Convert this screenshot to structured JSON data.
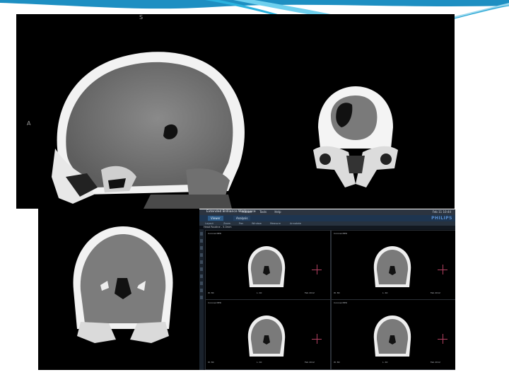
{
  "slide": {
    "accent": "#1a9fd0",
    "accent_light": "#7fd3ee"
  },
  "panels": {
    "sagittal": {
      "orientation_top": "S",
      "orientation_left": "A"
    }
  },
  "workstation": {
    "title": "Extended Brilliance Workspace",
    "menu_items": [
      "Patient",
      "Tools",
      "Help"
    ],
    "clock": "Feb 11 10:44",
    "tabs": [
      "Viewer",
      "Analysis"
    ],
    "logo": "PHILIPS",
    "toolbar_items": [
      "Layout",
      "Zoom",
      "Pan",
      "Window",
      "Measure",
      "Annotate"
    ],
    "series_label": "Head Routine - 5.0mm",
    "viewport_caption": "Coronal MPR",
    "window_width": "W: 80",
    "window_level": "L: 40",
    "date_label": "Feb 2012"
  },
  "colors": {
    "panel_bg": "#000000",
    "workstation_bg": "#0b0f16"
  }
}
